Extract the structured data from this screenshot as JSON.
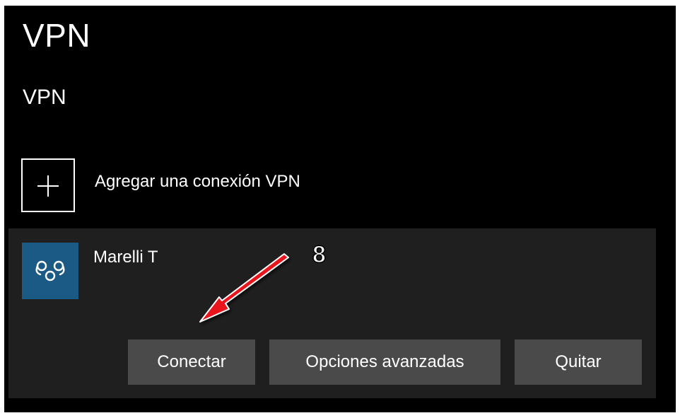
{
  "page": {
    "title": "VPN"
  },
  "section": {
    "title": "VPN"
  },
  "add_connection": {
    "label": "Agregar una conexión VPN",
    "icon": "plus-icon"
  },
  "connections": [
    {
      "name": "Marelli T",
      "icon": "vpn-connection-icon",
      "icon_color": "#1c5a86",
      "buttons": {
        "connect": "Conectar",
        "advanced": "Opciones avanzadas",
        "remove": "Quitar"
      }
    }
  ],
  "annotation": {
    "number": "8",
    "arrow_color": "#e8121c"
  },
  "colors": {
    "background": "#000000",
    "item_background": "#1f1f1f",
    "button_background": "#4a4a4a",
    "text": "#ffffff"
  }
}
